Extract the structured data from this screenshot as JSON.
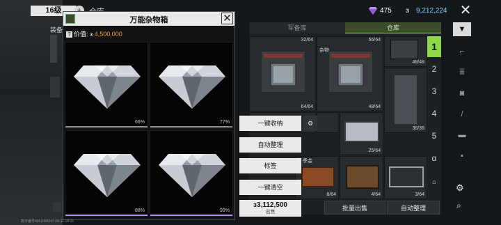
{
  "header": {
    "level": "16级",
    "level_plus": "+",
    "title": "仓库",
    "gems": "475",
    "coins": "9,212,224",
    "coin_icon": "з",
    "close": "✕"
  },
  "left_panel": {
    "tab_label": "装备"
  },
  "modal": {
    "title": "万能杂物箱",
    "close": "✕",
    "price_label": "价值:",
    "price_icon": "з",
    "price_value": "4,500,000",
    "items": [
      {
        "name": "diamond",
        "percent": "66%",
        "bar_color": "#8a8f93",
        "fill": 0.66
      },
      {
        "name": "diamond",
        "percent": "77%",
        "bar_color": "#8a8f93",
        "fill": 0.77
      },
      {
        "name": "diamond",
        "percent": "88%",
        "bar_color": "#b48df2",
        "fill": 0.88
      },
      {
        "name": "diamond",
        "percent": "99%",
        "bar_color": "#b48df2",
        "fill": 0.99
      }
    ]
  },
  "storage": {
    "tabs": [
      "军备库",
      "仓库"
    ],
    "active_tab": "仓库",
    "slots": [
      {
        "count": "32/64"
      },
      {
        "count": "56/64",
        "label": "杂物"
      },
      {
        "count": "48/48"
      },
      {
        "count": "64/64"
      },
      {
        "count": "48/64"
      },
      {
        "count": "36/36"
      },
      {
        "count": "25/64"
      },
      {
        "count": "8/64",
        "label": "季金"
      },
      {
        "count": "4/64"
      },
      {
        "count": "3/64"
      }
    ],
    "pages": [
      "1",
      "2",
      "3",
      "4",
      "5",
      "α"
    ],
    "active_page": "1",
    "bottom_buttons": [
      "批量出售",
      "自动整理"
    ]
  },
  "actions": {
    "collect_all": "一键收纳",
    "auto_sort": "自动整理",
    "tag": "标签",
    "clear_all": "一键清空",
    "sell_amount": "3,112,500",
    "sell_icon": "з",
    "sell_label": "出售"
  },
  "side_icons": [
    "filter-icon",
    "pistol-icon",
    "ammo-icon",
    "camera-icon",
    "knife-icon",
    "card-icon",
    "misc-icon"
  ],
  "footer": {
    "player_id": "数字编号4851689247-08-11-18:15"
  },
  "colors": {
    "accent_green": "#8fd64a",
    "price_orange": "#f0a232",
    "coin_blue": "#7fd0ff"
  }
}
